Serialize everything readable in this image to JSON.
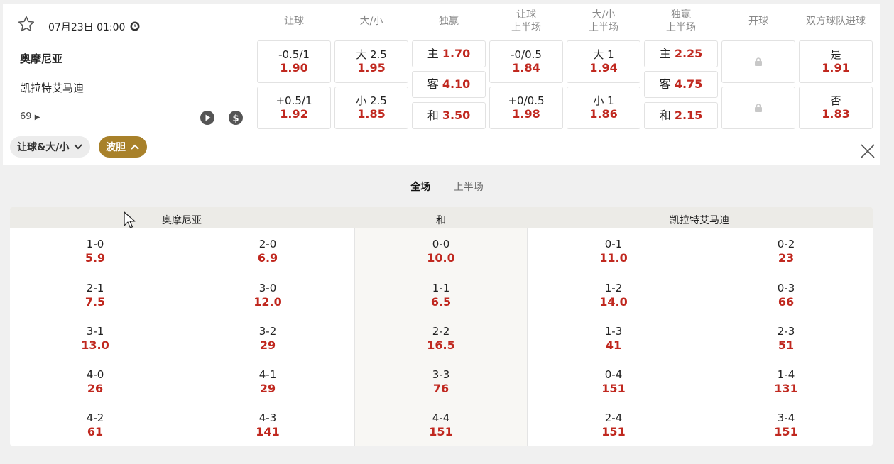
{
  "match": {
    "datetime": "07月23日 01:00",
    "home_team": "奥摩尼亚",
    "away_team": "凯拉特艾马迪",
    "more_count": "69"
  },
  "columns": [
    {
      "line1": "让球",
      "line2": ""
    },
    {
      "line1": "大/小",
      "line2": ""
    },
    {
      "line1": "独赢",
      "line2": ""
    },
    {
      "line1": "让球",
      "line2": "上半场"
    },
    {
      "line1": "大/小",
      "line2": "上半场"
    },
    {
      "line1": "独赢",
      "line2": "上半场"
    },
    {
      "line1": "开球",
      "line2": ""
    },
    {
      "line1": "双方球队进球",
      "line2": ""
    }
  ],
  "odds": {
    "handicap": [
      {
        "label": "-0.5/1",
        "value": "1.90"
      },
      {
        "label": "+0.5/1",
        "value": "1.92"
      }
    ],
    "over_under": [
      {
        "label": "大 2.5",
        "value": "1.95"
      },
      {
        "label": "小 2.5",
        "value": "1.85"
      }
    ],
    "moneyline": [
      {
        "label": "主",
        "value": "1.70"
      },
      {
        "label": "客",
        "value": "4.10"
      },
      {
        "label": "和",
        "value": "3.50"
      }
    ],
    "handicap_1h": [
      {
        "label": "-0/0.5",
        "value": "1.84"
      },
      {
        "label": "+0/0.5",
        "value": "1.98"
      }
    ],
    "over_under_1h": [
      {
        "label": "大 1",
        "value": "1.94"
      },
      {
        "label": "小 1",
        "value": "1.86"
      }
    ],
    "moneyline_1h": [
      {
        "label": "主",
        "value": "2.25"
      },
      {
        "label": "客",
        "value": "4.75"
      },
      {
        "label": "和",
        "value": "2.15"
      }
    ],
    "both_teams_score": [
      {
        "label": "是",
        "value": "1.91"
      },
      {
        "label": "否",
        "value": "1.83"
      }
    ]
  },
  "filters": {
    "handicap_ou": "让球&大/小",
    "correct_score": "波胆"
  },
  "tabs": {
    "full_time": "全场",
    "first_half": "上半场"
  },
  "correct_score": {
    "headers": {
      "home": "奥摩尼亚",
      "draw": "和",
      "away": "凯拉特艾马迪"
    },
    "rows": [
      [
        {
          "s": "1-0",
          "o": "5.9"
        },
        {
          "s": "2-0",
          "o": "6.9"
        },
        {
          "s": "0-0",
          "o": "10.0"
        },
        {
          "s": "0-1",
          "o": "11.0"
        },
        {
          "s": "0-2",
          "o": "23"
        }
      ],
      [
        {
          "s": "2-1",
          "o": "7.5"
        },
        {
          "s": "3-0",
          "o": "12.0"
        },
        {
          "s": "1-1",
          "o": "6.5"
        },
        {
          "s": "1-2",
          "o": "14.0"
        },
        {
          "s": "0-3",
          "o": "66"
        }
      ],
      [
        {
          "s": "3-1",
          "o": "13.0"
        },
        {
          "s": "3-2",
          "o": "29"
        },
        {
          "s": "2-2",
          "o": "16.5"
        },
        {
          "s": "1-3",
          "o": "41"
        },
        {
          "s": "2-3",
          "o": "51"
        }
      ],
      [
        {
          "s": "4-0",
          "o": "26"
        },
        {
          "s": "4-1",
          "o": "29"
        },
        {
          "s": "3-3",
          "o": "76"
        },
        {
          "s": "0-4",
          "o": "151"
        },
        {
          "s": "1-4",
          "o": "131"
        }
      ],
      [
        {
          "s": "4-2",
          "o": "61"
        },
        {
          "s": "4-3",
          "o": "141"
        },
        {
          "s": "4-4",
          "o": "151"
        },
        {
          "s": "2-4",
          "o": "151"
        },
        {
          "s": "3-4",
          "o": "151"
        }
      ]
    ]
  },
  "colors": {
    "odds_red": "#c0281f",
    "accent_gold": "#a8812a"
  }
}
